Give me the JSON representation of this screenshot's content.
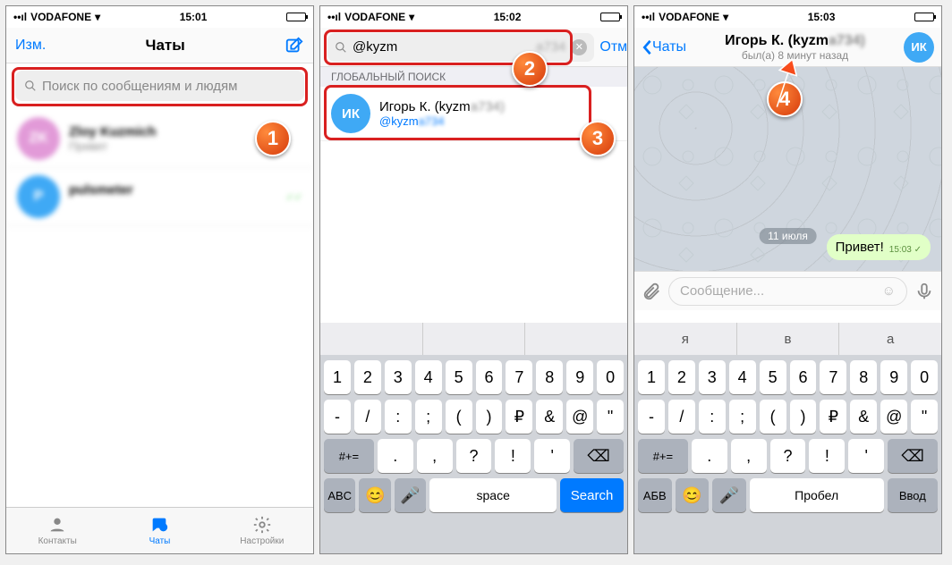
{
  "status": {
    "carrier": "VODAFONE",
    "wifi": "●"
  },
  "screens": [
    {
      "time": "15:01",
      "nav": {
        "left": "Изм.",
        "title": "Чаты"
      },
      "search_placeholder": "Поиск по сообщениям и людям",
      "chats": [
        {
          "initials": "ZK",
          "color": "#e29ad8",
          "name": "Zloy Kuzmich",
          "msg": "Привет"
        },
        {
          "initials": "P",
          "color": "#3fa9f5",
          "name": "pulsmeter",
          "msg": ""
        }
      ],
      "tabs": {
        "contacts": "Контакты",
        "chats": "Чаты",
        "settings": "Настройки"
      },
      "badge": "1"
    },
    {
      "time": "15:02",
      "search_value": "@kyzm",
      "cancel": "Отмена",
      "section_header": "ГЛОБАЛЬНЫЙ ПОИСК",
      "result": {
        "initials": "ИК",
        "color": "#3fa9f5",
        "name": "Игорь К. (kyzm",
        "handle": "@kyzm"
      },
      "keyboard": {
        "suggestions": [
          "",
          "",
          ""
        ],
        "row1": [
          "1",
          "2",
          "3",
          "4",
          "5",
          "6",
          "7",
          "8",
          "9",
          "0"
        ],
        "row2": [
          "-",
          "/",
          ":",
          ";",
          "(",
          ")",
          "₽",
          "&",
          "@",
          "\""
        ],
        "row3_sym": "#+=",
        "row3": [
          ".",
          ",",
          "?",
          "!",
          "'"
        ],
        "row3_bksp": "⌫",
        "bottom": {
          "abc": "ABC",
          "emoji": "😊",
          "mic": "🎤",
          "space": "space",
          "action": "Search"
        }
      },
      "badges": [
        "2",
        "3"
      ]
    },
    {
      "time": "15:03",
      "back": "Чаты",
      "header": {
        "name": "Игорь К. (kyzm",
        "status": "был(а) 8 минут назад",
        "initials": "ИК",
        "color": "#3fa9f5"
      },
      "date": "11 июля",
      "message": {
        "text": "Привет!",
        "time": "15:03"
      },
      "input_placeholder": "Сообщение...",
      "keyboard": {
        "suggestions": [
          "я",
          "в",
          "а"
        ],
        "row1": [
          "1",
          "2",
          "3",
          "4",
          "5",
          "6",
          "7",
          "8",
          "9",
          "0"
        ],
        "row2": [
          "-",
          "/",
          ":",
          ";",
          "(",
          ")",
          "₽",
          "&",
          "@",
          "\""
        ],
        "row3_sym": "#+=",
        "row3": [
          ".",
          ",",
          "?",
          "!",
          "'"
        ],
        "row3_bksp": "⌫",
        "bottom": {
          "abc": "АБВ",
          "emoji": "😊",
          "mic": "🎤",
          "space": "Пробел",
          "action": "Ввод"
        }
      },
      "badge": "4"
    }
  ]
}
